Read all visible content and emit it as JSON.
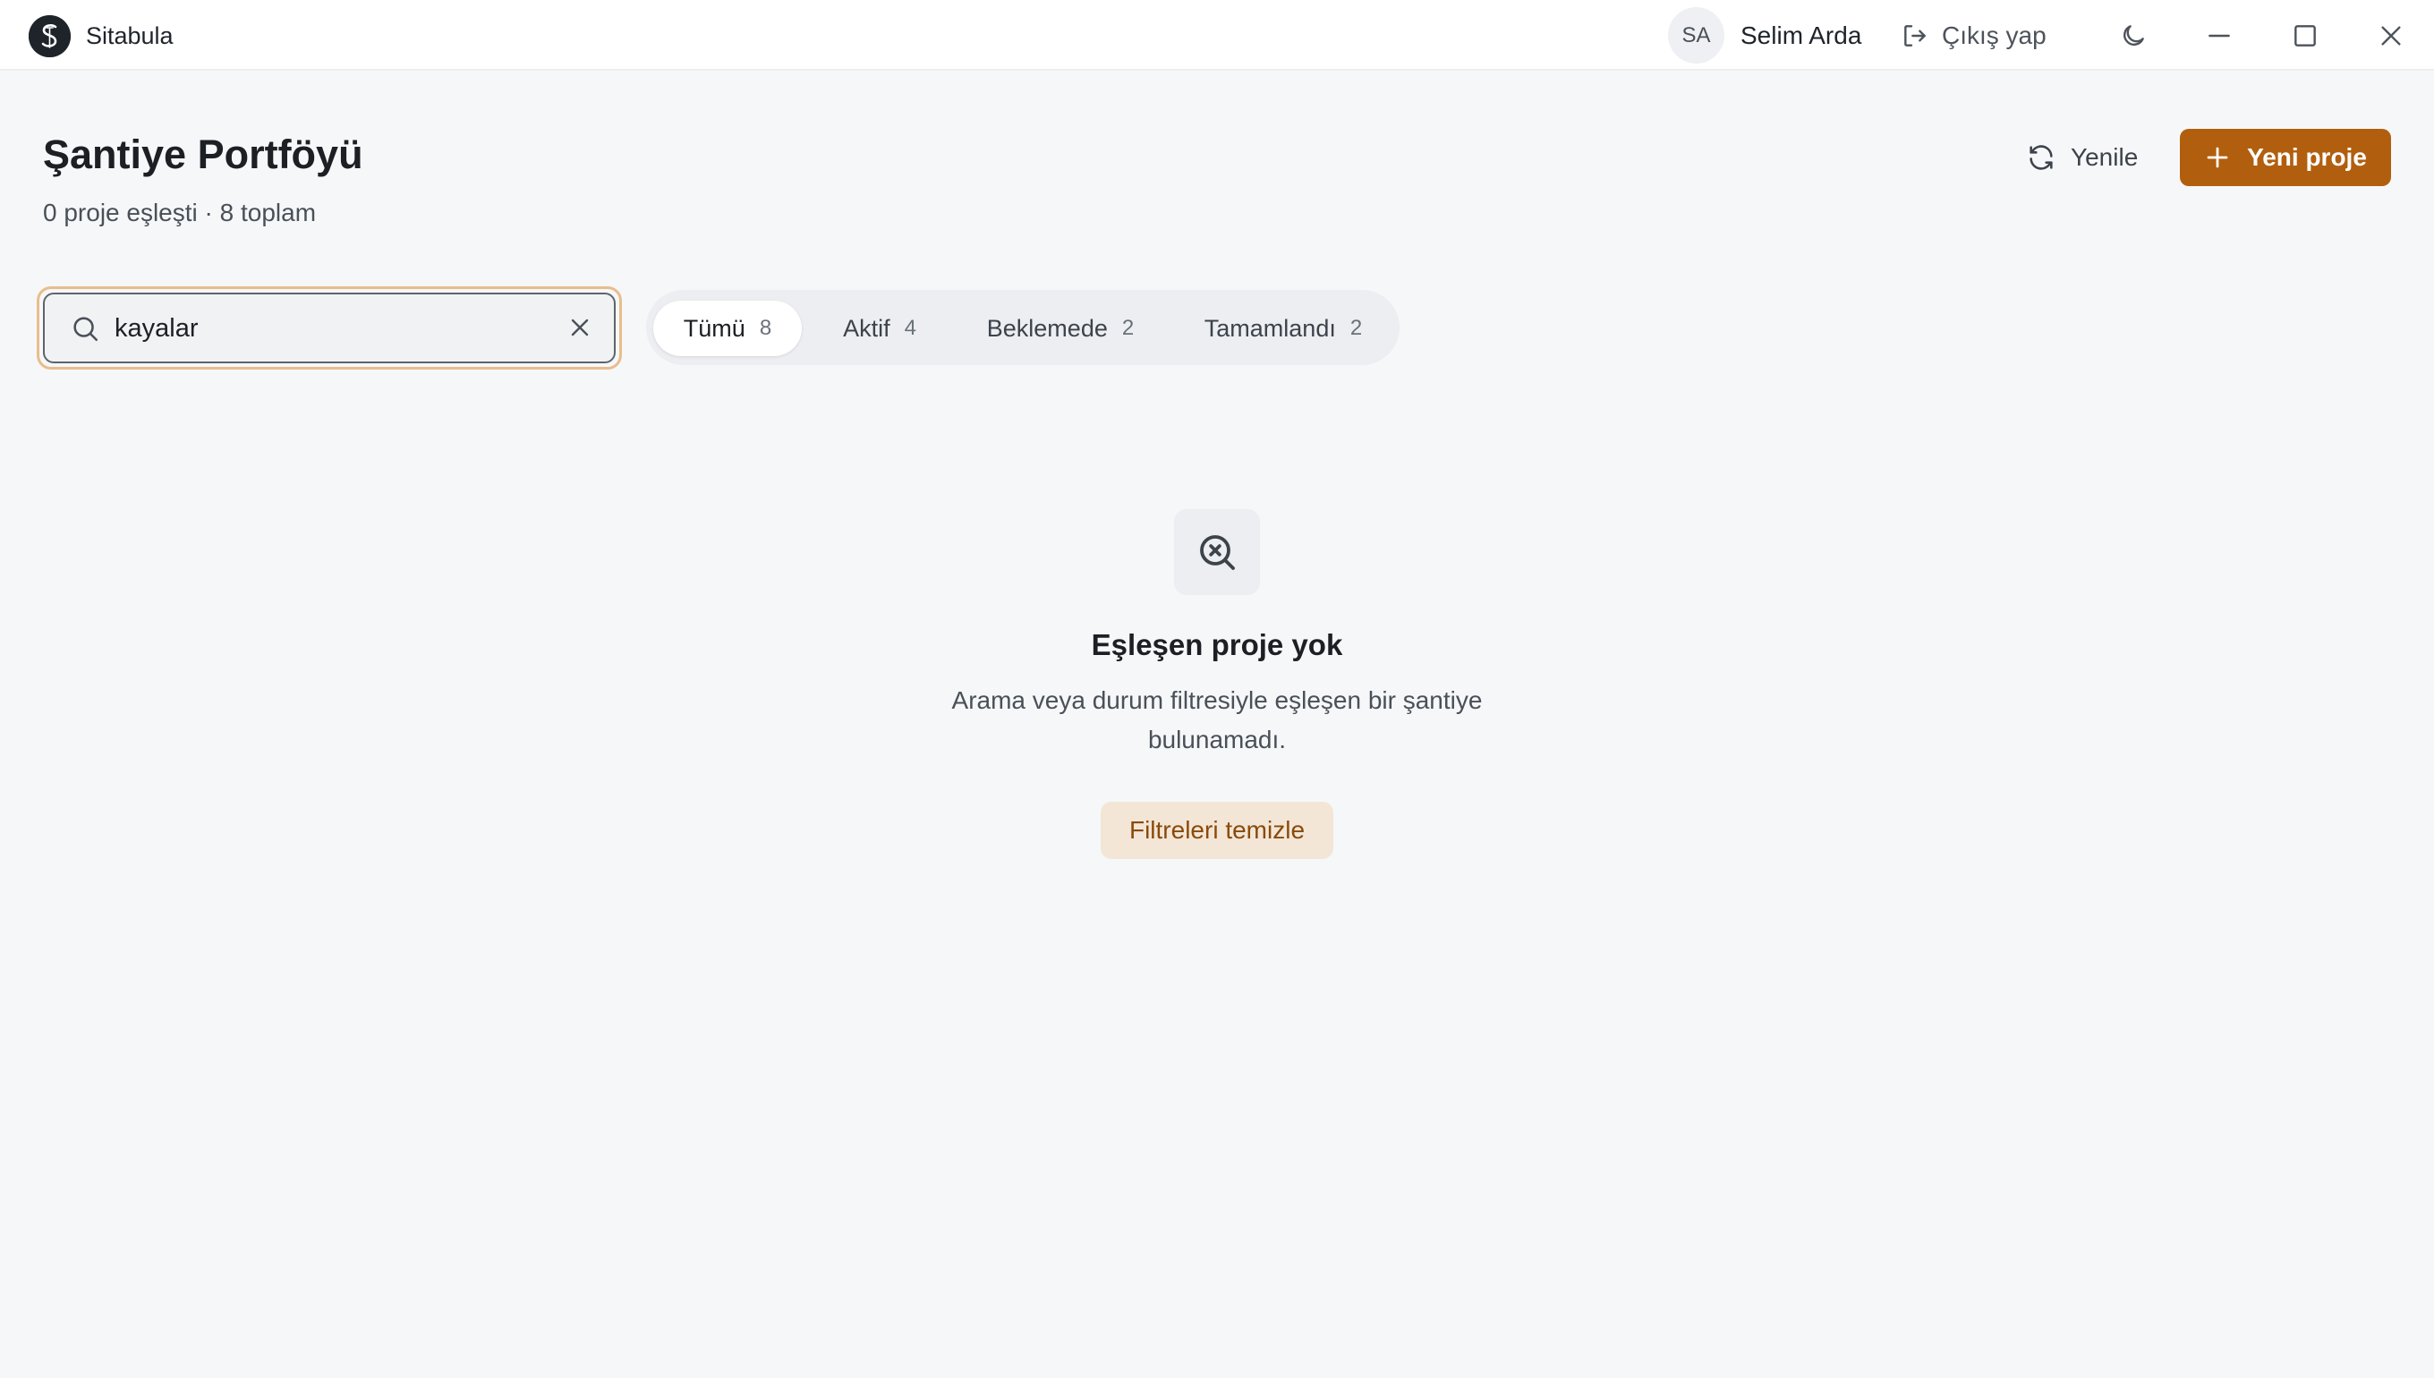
{
  "app": {
    "name": "Sitabula"
  },
  "user": {
    "initials": "SA",
    "name": "Selim Arda",
    "logout_label": "Çıkış yap"
  },
  "header": {
    "title": "Şantiye Portföyü",
    "subtitle": "0 proje eşleşti · 8 toplam",
    "refresh_label": "Yenile",
    "new_project_label": "Yeni proje"
  },
  "search": {
    "value": "kayalar"
  },
  "filters": [
    {
      "label": "Tümü",
      "count": "8",
      "active": true
    },
    {
      "label": "Aktif",
      "count": "4",
      "active": false
    },
    {
      "label": "Beklemede",
      "count": "2",
      "active": false
    },
    {
      "label": "Tamamlandı",
      "count": "2",
      "active": false
    }
  ],
  "empty_state": {
    "title": "Eşleşen proje yok",
    "description": "Arama veya durum filtresiyle eşleşen bir şantiye bulunamadı.",
    "button_label": "Filtreleri temizle"
  },
  "colors": {
    "accent": "#b15f0e",
    "accent_soft": "#f3e6d6",
    "focus_ring": "#e8bd8c",
    "background": "#f6f7f9"
  },
  "icons": {
    "logo": "sitabula-logo-icon",
    "logout": "logout-icon",
    "theme": "moon-icon",
    "minimize": "minimize-icon",
    "maximize": "maximize-icon",
    "close": "close-icon",
    "refresh": "refresh-icon",
    "add": "plus-icon",
    "search": "search-icon",
    "clear": "clear-icon",
    "empty": "search-x-icon"
  }
}
